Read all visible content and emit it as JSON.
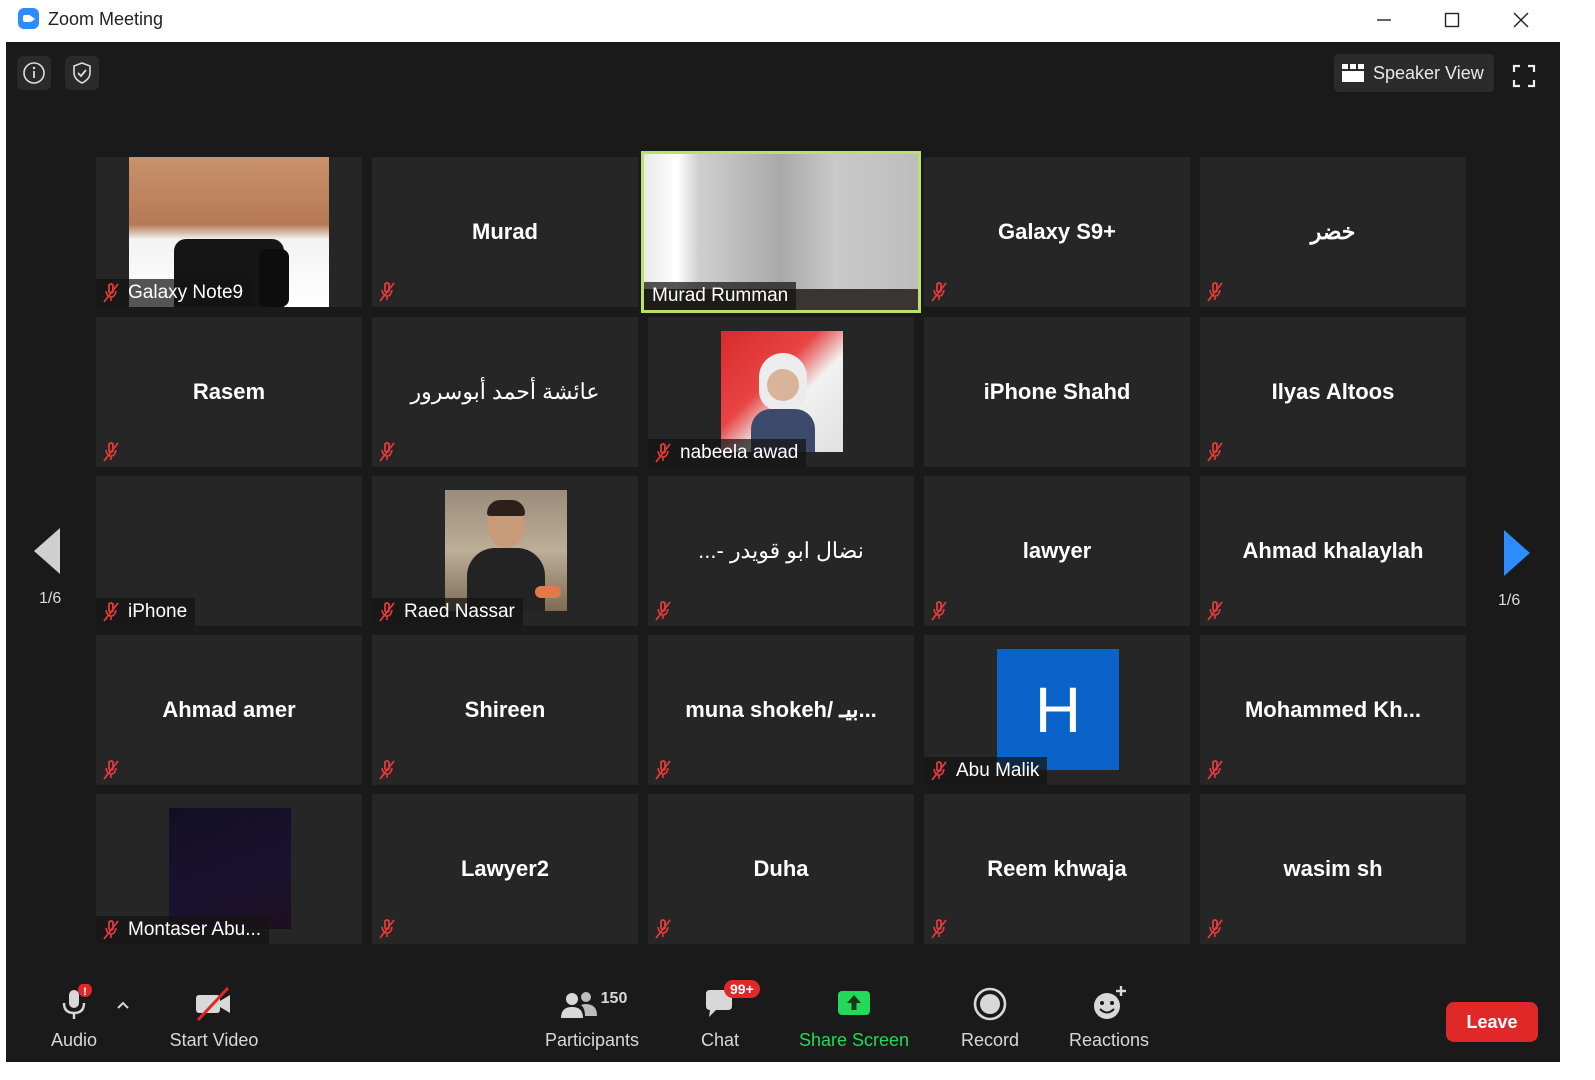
{
  "window": {
    "title": "Zoom Meeting",
    "minimize_icon": "minimize-icon",
    "maximize_icon": "maximize-icon",
    "close_icon": "close-icon"
  },
  "top_bar": {
    "info_icon": "info-icon",
    "security_icon": "shield-check-icon",
    "view_button": "Speaker View",
    "fullscreen_icon": "fullscreen-icon"
  },
  "pagination": {
    "left": "1/6",
    "right": "1/6"
  },
  "tiles": [
    {
      "name": "Galaxy Note9",
      "muted": true,
      "video": true
    },
    {
      "name": "Murad",
      "muted": true,
      "video": false
    },
    {
      "name": "Murad Rumman",
      "muted": false,
      "video": true,
      "active_speaker": true
    },
    {
      "name": "Galaxy S9+",
      "muted": true,
      "video": false
    },
    {
      "name": "خضر",
      "muted": true,
      "video": false
    },
    {
      "name": "Rasem",
      "muted": true,
      "video": false
    },
    {
      "name": "عائشة أحمد أبوسرور",
      "muted": true,
      "video": false
    },
    {
      "name": "nabeela awad",
      "muted": true,
      "video": true
    },
    {
      "name": "iPhone Shahd",
      "muted": false,
      "video": false
    },
    {
      "name": "Ilyas Altoos",
      "muted": true,
      "video": false
    },
    {
      "name": "iPhone",
      "muted": true,
      "video": false
    },
    {
      "name": "Raed Nassar",
      "muted": true,
      "video": true
    },
    {
      "name": "...- نضال ابو قويدر",
      "muted": true,
      "video": false
    },
    {
      "name": "lawyer",
      "muted": true,
      "video": false
    },
    {
      "name": "Ahmad khalaylah",
      "muted": true,
      "video": false
    },
    {
      "name": "Ahmad amer",
      "muted": true,
      "video": false
    },
    {
      "name": "Shireen",
      "muted": true,
      "video": false
    },
    {
      "name": "muna shokeh/ بيـ...",
      "muted": true,
      "video": false
    },
    {
      "name": "Abu Malik",
      "muted": true,
      "video": true,
      "avatar_letter": "H"
    },
    {
      "name": "Mohammed Kh...",
      "muted": true,
      "video": false
    },
    {
      "name": "Montaser Abu...",
      "muted": true,
      "video": true
    },
    {
      "name": "Lawyer2",
      "muted": true,
      "video": false
    },
    {
      "name": "Duha",
      "muted": true,
      "video": false
    },
    {
      "name": "Reem khwaja",
      "muted": true,
      "video": false
    },
    {
      "name": "wasim sh",
      "muted": true,
      "video": false
    }
  ],
  "toolbar": {
    "audio": "Audio",
    "start_video": "Start Video",
    "participants": "Participants",
    "participants_count": "150",
    "chat": "Chat",
    "chat_badge": "99+",
    "share_screen": "Share Screen",
    "record": "Record",
    "reactions": "Reactions",
    "leave": "Leave"
  },
  "colors": {
    "background": "#1a1a1a",
    "tile": "#262626",
    "active_border": "#b8e26b",
    "share_green": "#23d959",
    "leave_red": "#e02828",
    "nav_blue": "#2d8cff",
    "avatar_blue": "#0a63c9"
  }
}
